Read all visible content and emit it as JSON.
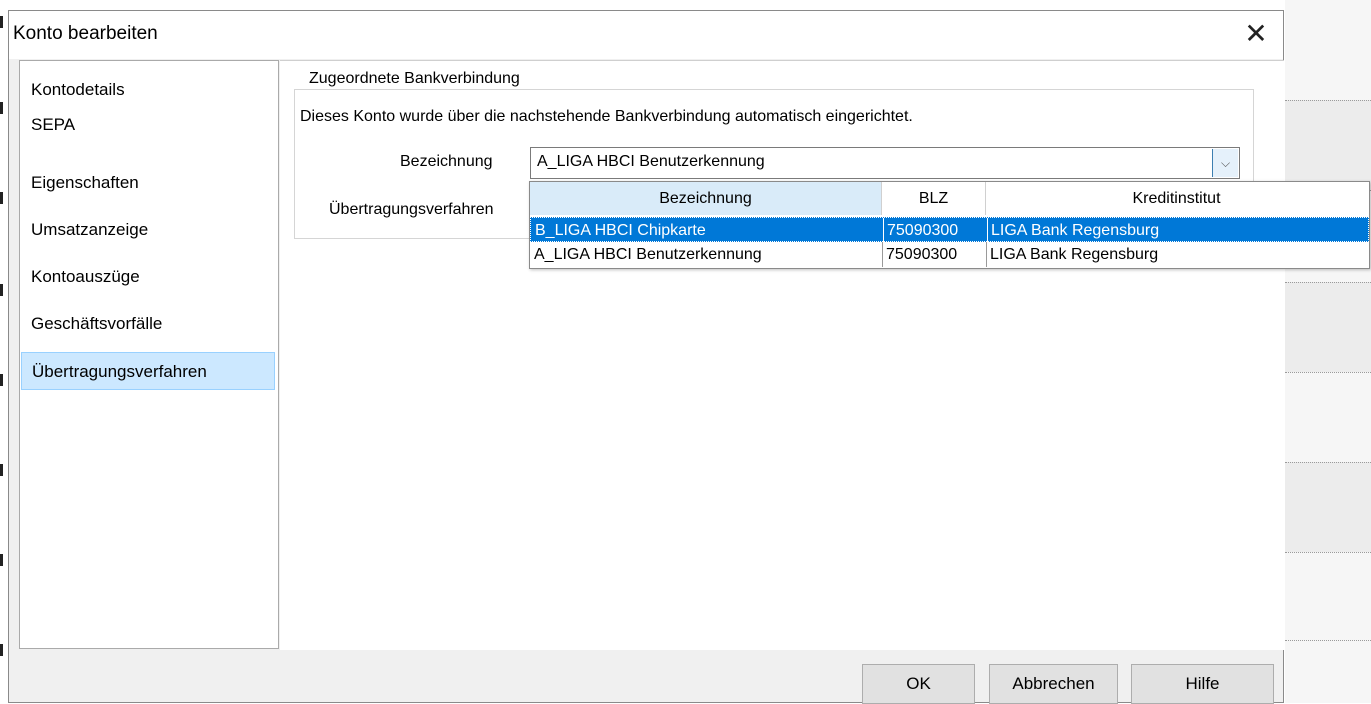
{
  "dialog": {
    "title": "Konto bearbeiten",
    "close_symbol": "✕"
  },
  "nav": {
    "items": [
      {
        "label": "Kontodetails"
      },
      {
        "label": "SEPA"
      },
      {
        "label": "Eigenschaften"
      },
      {
        "label": "Umsatzanzeige"
      },
      {
        "label": "Kontoauszüge"
      },
      {
        "label": "Geschäftsvorfälle"
      },
      {
        "label": "Übertragungsverfahren"
      }
    ],
    "selected": "Übertragungsverfahren"
  },
  "group": {
    "legend": "Zugeordnete Bankverbindung",
    "description": "Dieses Konto wurde über die nachstehende Bankverbindung automatisch eingerichtet.",
    "bezeichnung_label": "Bezeichnung",
    "uebertragung_label": "Übertragungsverfahren",
    "combo_value": "A_LIGA HBCI Benutzerkennung",
    "combo_arrow": "⌵"
  },
  "dropdown": {
    "columns": [
      "Bezeichnung",
      "BLZ",
      "Kreditinstitut"
    ],
    "rows": [
      {
        "bezeichnung": "B_LIGA HBCI Chipkarte",
        "blz": "75090300",
        "institut": "LIGA Bank Regensburg",
        "selected": true
      },
      {
        "bezeichnung": "A_LIGA HBCI Benutzerkennung",
        "blz": "75090300",
        "institut": "LIGA Bank Regensburg",
        "selected": false
      }
    ]
  },
  "buttons": {
    "ok": "OK",
    "cancel": "Abbrechen",
    "help": "Hilfe"
  },
  "colors": {
    "selection": "#0078d7",
    "nav_selection": "#cce8ff"
  }
}
